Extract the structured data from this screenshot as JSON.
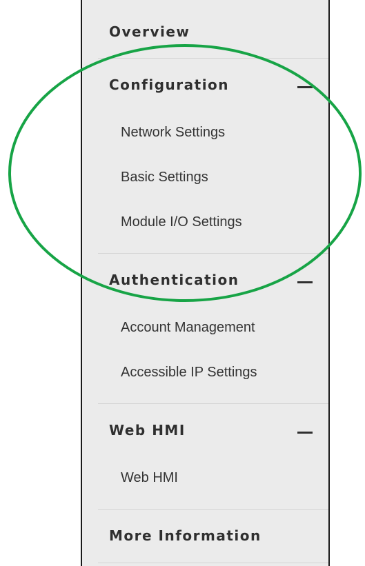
{
  "nav": {
    "overview": "Overview",
    "configuration": {
      "title": "Configuration",
      "items": [
        "Network Settings",
        "Basic Settings",
        "Module I/O Settings"
      ]
    },
    "authentication": {
      "title": "Authentication",
      "items": [
        "Account Management",
        "Accessible IP Settings"
      ]
    },
    "web_hmi": {
      "title": "Web HMI",
      "items": [
        "Web HMI"
      ]
    },
    "more_information": "More Information"
  },
  "highlight_color": "#17a446"
}
